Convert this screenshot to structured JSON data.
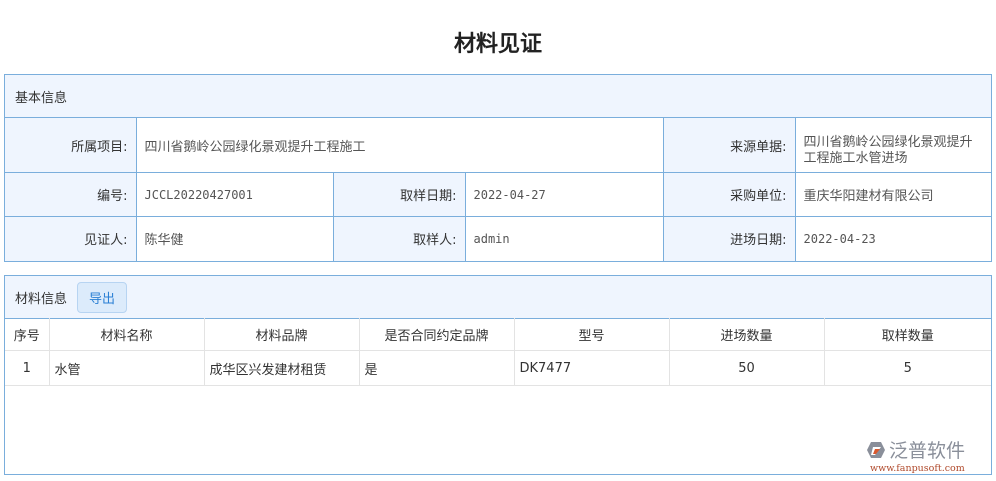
{
  "page_title": "材料见证",
  "basic": {
    "header": "基本信息",
    "project_label": "所属项目:",
    "project": "四川省鹅岭公园绿化景观提升工程施工",
    "source_label": "来源单据:",
    "source": "四川省鹅岭公园绿化景观提升工程施工水管进场",
    "code_label": "编号:",
    "code": "JCCL20220427001",
    "sample_date_label": "取样日期:",
    "sample_date": "2022-04-27",
    "purchaser_label": "采购单位:",
    "purchaser": "重庆华阳建材有限公司",
    "witness_label": "见证人:",
    "witness": "陈华健",
    "sampler_label": "取样人:",
    "sampler": "admin",
    "entry_date_label": "进场日期:",
    "entry_date": "2022-04-23"
  },
  "materials": {
    "header": "材料信息",
    "export_label": "导出",
    "columns": [
      "序号",
      "材料名称",
      "材料品牌",
      "是否合同约定品牌",
      "型号",
      "进场数量",
      "取样数量"
    ],
    "rows": [
      [
        "1",
        "水管",
        "成华区兴发建材租赁",
        "是",
        "DK7477",
        "50",
        "5"
      ]
    ]
  },
  "logo": {
    "name": "泛普软件",
    "url": "www.fanpusoft.com"
  }
}
